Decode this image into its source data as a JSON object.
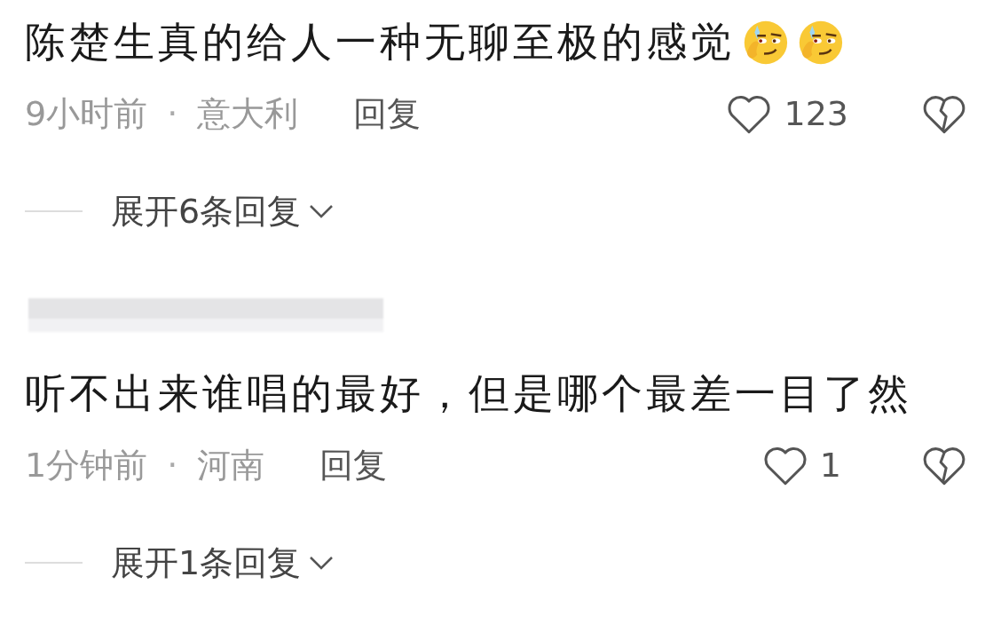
{
  "comments": [
    {
      "text": "陈楚生真的给人一种无聊至极的感觉",
      "emojis": [
        {
          "kind": "smirk"
        },
        {
          "kind": "smirk"
        }
      ],
      "time": "9小时前",
      "separator": "·",
      "location": "意大利",
      "reply": "回复",
      "likes": "123",
      "liked": false,
      "expand": "展开6条回复"
    },
    {
      "author": {
        "redacted": true
      },
      "text": "听不出来谁唱的最好，但是哪个最差一目了然",
      "time": "1分钟前",
      "separator": "·",
      "location": "河南",
      "reply": "回复",
      "likes": "1",
      "liked": false,
      "expand": "展开1条回复"
    }
  ]
}
